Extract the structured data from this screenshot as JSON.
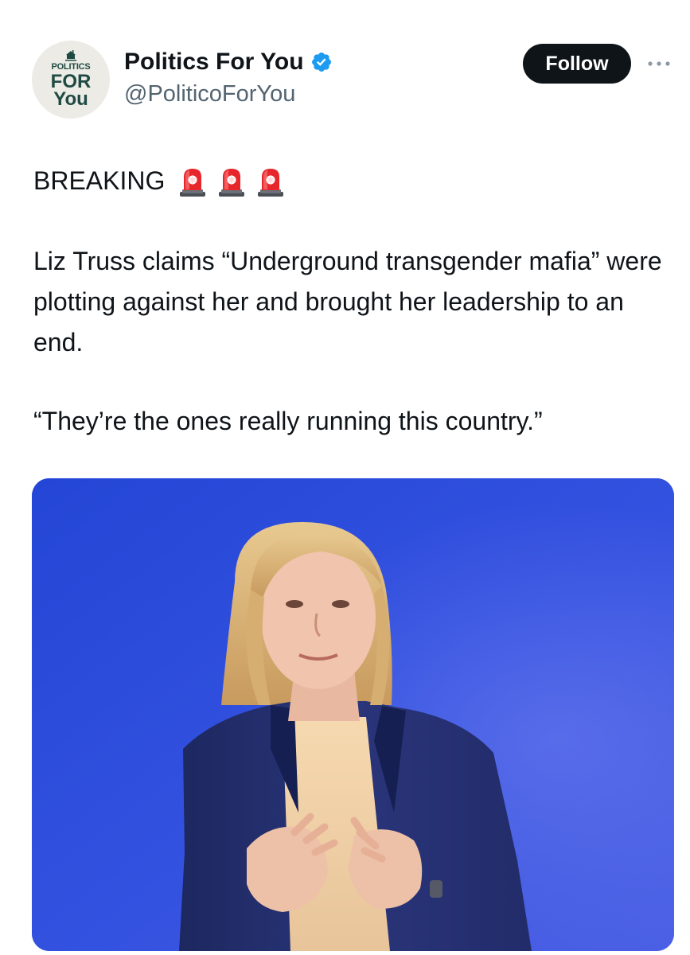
{
  "account": {
    "avatar_text": {
      "line1": "POLITICS",
      "line2": "FOR",
      "line3": "You"
    },
    "display_name": "Politics For You",
    "handle": "@PoliticoForYou",
    "verified": true
  },
  "actions": {
    "follow_label": "Follow",
    "more_icon": "more-dots-icon"
  },
  "post": {
    "heading": "BREAKING",
    "heading_emoji": [
      "siren-icon",
      "siren-icon",
      "siren-icon"
    ],
    "paragraph1": "Liz Truss claims “Underground transgender mafia” were plotting against her and brought her leadership to an end.",
    "paragraph2": "“They’re the ones really running this country.”"
  },
  "media": {
    "type": "photo"
  },
  "colors": {
    "text": "#0f1419",
    "secondary": "#536471",
    "verified": "#1d9bf0",
    "button_bg": "#0f1419",
    "photo_background": "#2c4bd8"
  }
}
